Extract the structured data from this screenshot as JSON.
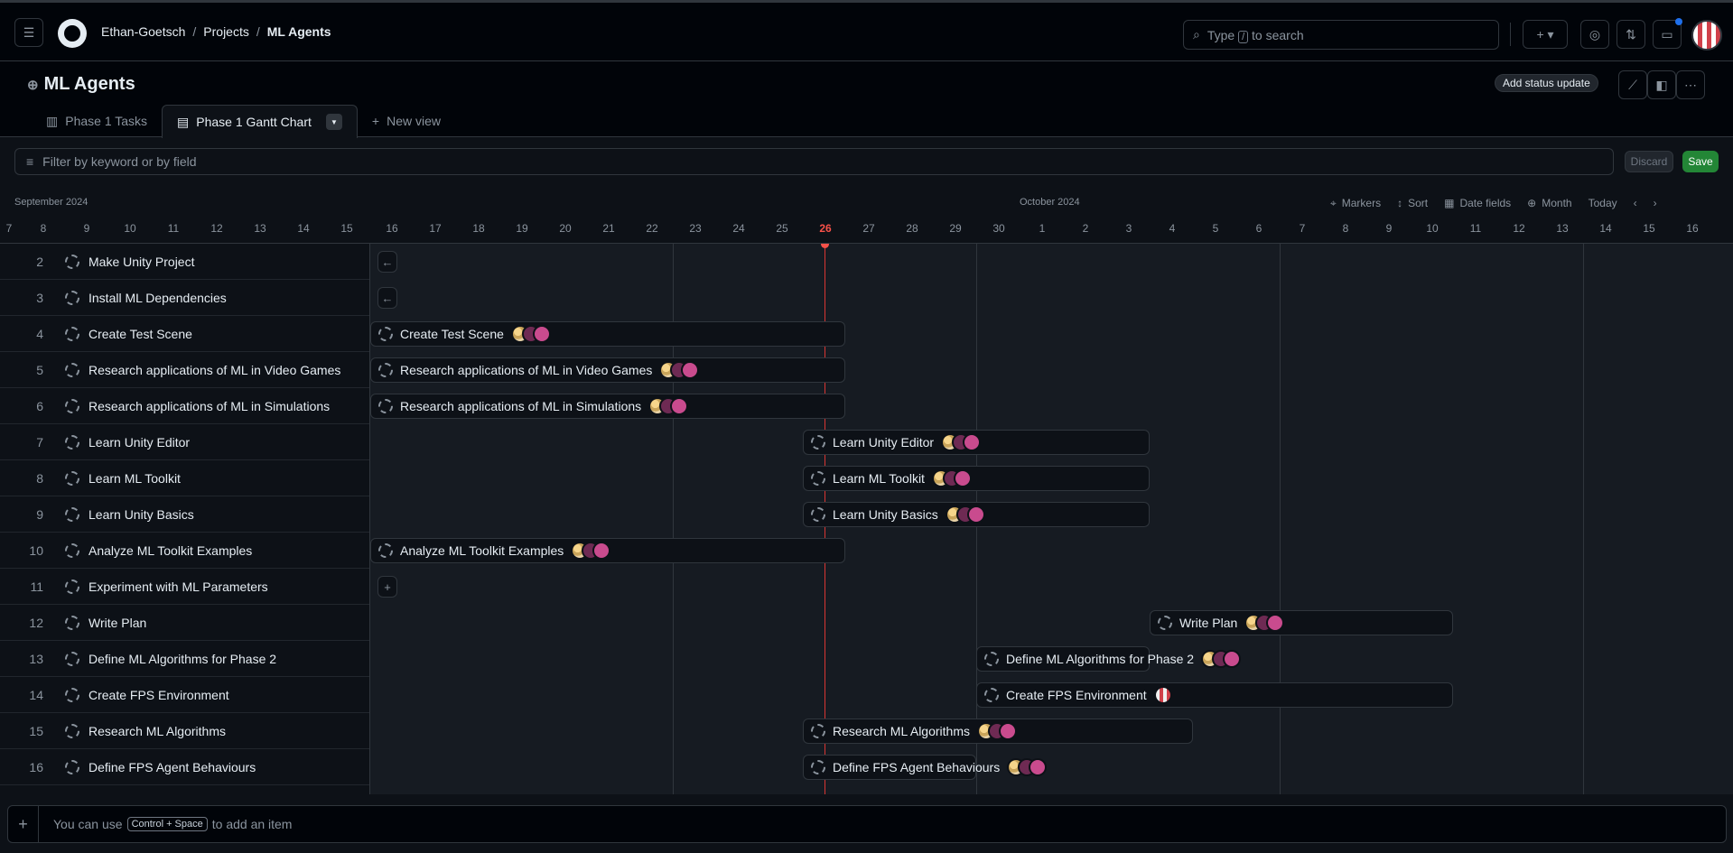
{
  "nav": {
    "breadcrumb": [
      "Ethan-Goetsch",
      "Projects",
      "ML Agents"
    ],
    "search_placeholder_before": "Type",
    "search_key": "/",
    "search_placeholder_after": "to search"
  },
  "project": {
    "title": "ML Agents",
    "status_update_label": "Add status update"
  },
  "tabs": [
    {
      "label": "Phase 1 Tasks",
      "active": false
    },
    {
      "label": "Phase 1 Gantt Chart",
      "active": true
    }
  ],
  "new_view_label": "New view",
  "filter": {
    "placeholder": "Filter by keyword or by field",
    "discard_label": "Discard",
    "save_label": "Save"
  },
  "timeline": {
    "month_labels": [
      "September 2024",
      "October 2024"
    ],
    "today_day": "26",
    "days": [
      "7",
      "8",
      "9",
      "10",
      "11",
      "12",
      "13",
      "14",
      "15",
      "16",
      "17",
      "18",
      "19",
      "20",
      "21",
      "22",
      "23",
      "24",
      "25",
      "26",
      "27",
      "28",
      "29",
      "30",
      "1",
      "2",
      "3",
      "4",
      "5",
      "6",
      "7",
      "8",
      "9",
      "10",
      "11",
      "12",
      "13",
      "14",
      "15",
      "16"
    ],
    "controls": {
      "markers": "Markers",
      "sort": "Sort",
      "date_fields": "Date fields",
      "zoom": "Month",
      "today": "Today"
    }
  },
  "items": [
    {
      "num": "2",
      "title": "Make Unity Project"
    },
    {
      "num": "3",
      "title": "Install ML Dependencies"
    },
    {
      "num": "4",
      "title": "Create Test Scene"
    },
    {
      "num": "5",
      "title": "Research applications of ML in Video Games"
    },
    {
      "num": "6",
      "title": "Research applications of ML in Simulations"
    },
    {
      "num": "7",
      "title": "Learn Unity Editor"
    },
    {
      "num": "8",
      "title": "Learn ML Toolkit"
    },
    {
      "num": "9",
      "title": "Learn Unity Basics"
    },
    {
      "num": "10",
      "title": "Analyze ML Toolkit Examples"
    },
    {
      "num": "11",
      "title": "Experiment with ML Parameters"
    },
    {
      "num": "12",
      "title": "Write Plan"
    },
    {
      "num": "13",
      "title": "Define ML Algorithms for Phase 2"
    },
    {
      "num": "14",
      "title": "Create FPS Environment"
    },
    {
      "num": "15",
      "title": "Research ML Algorithms"
    },
    {
      "num": "16",
      "title": "Define FPS Agent Behaviours"
    }
  ],
  "footer": {
    "text_before": "You can use",
    "shortcut": "Control + Space",
    "text_after": "to add an item"
  }
}
